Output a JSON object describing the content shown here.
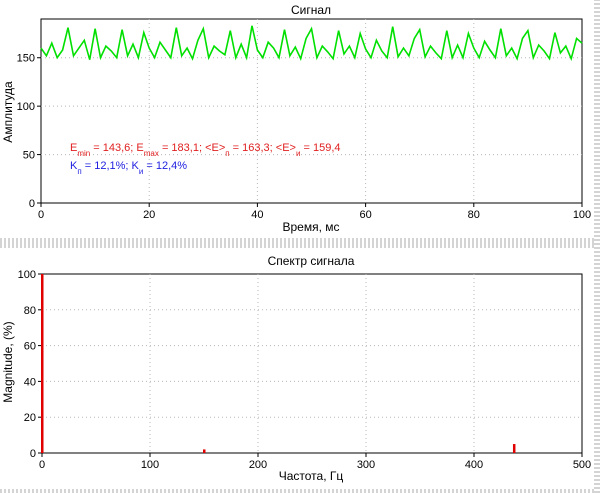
{
  "chart_data": [
    {
      "type": "line",
      "title": "Сигнал",
      "xlabel": "Время, мс",
      "ylabel": "Амплитуда",
      "xlim": [
        0,
        100
      ],
      "ylim": [
        0,
        190
      ],
      "xticks": [
        "0",
        "20",
        "40",
        "60",
        "80",
        "100"
      ],
      "yticks": [
        "0",
        "50",
        "100",
        "150"
      ],
      "grid": true,
      "color": "#00e000",
      "series": [
        {
          "x": [
            0,
            1,
            2,
            3,
            4,
            5,
            6,
            7,
            8,
            9,
            10,
            11,
            12,
            13,
            14,
            15,
            16,
            17,
            18,
            19,
            20,
            21,
            22,
            23,
            24,
            25,
            26,
            27,
            28,
            29,
            30,
            31,
            32,
            33,
            34,
            35,
            36,
            37,
            38,
            39,
            40,
            41,
            42,
            43,
            44,
            45,
            46,
            47,
            48,
            49,
            50,
            51,
            52,
            53,
            54,
            55,
            56,
            57,
            58,
            59,
            60,
            61,
            62,
            63,
            64,
            65,
            66,
            67,
            68,
            69,
            70,
            71,
            72,
            73,
            74,
            75,
            76,
            77,
            78,
            79,
            80,
            81,
            82,
            83,
            84,
            85,
            86,
            87,
            88,
            89,
            90,
            91,
            92,
            93,
            94,
            95,
            96,
            97,
            98,
            99,
            100
          ],
          "y": [
            160,
            152,
            165,
            150,
            158,
            181,
            152,
            160,
            168,
            148,
            180,
            150,
            162,
            157,
            150,
            179,
            152,
            164,
            150,
            176,
            160,
            150,
            166,
            158,
            150,
            181,
            152,
            160,
            149,
            168,
            180,
            150,
            162,
            157,
            153,
            178,
            150,
            164,
            150,
            183,
            158,
            150,
            166,
            160,
            150,
            179,
            152,
            161,
            149,
            170,
            180,
            150,
            162,
            156,
            149,
            178,
            154,
            162,
            150,
            175,
            159,
            150,
            168,
            157,
            150,
            182,
            151,
            160,
            152,
            170,
            179,
            151,
            162,
            155,
            149,
            178,
            150,
            163,
            150,
            175,
            160,
            150,
            167,
            158,
            150,
            180,
            152,
            160,
            149,
            170,
            178,
            150,
            163,
            157,
            149,
            176,
            155,
            162,
            149,
            170,
            165
          ]
        }
      ],
      "annotation_line1": {
        "emin_label": "E",
        "emin_sub": "min",
        "emin_value": " = 143,6; ",
        "emax_label": "E",
        "emax_sub": "max",
        "emax_value": " = 183,1; ",
        "ep_label": "<E>",
        "ep_sub": "п",
        "ep_value": " = 163,3; ",
        "ei_label": "<E>",
        "ei_sub": "и",
        "ei_value": " = 159,4",
        "color": "#e02020"
      },
      "annotation_line2": {
        "kp_label": "K",
        "kp_sub": "п",
        "kp_value": " = 12,1%; ",
        "ki_label": "K",
        "ki_sub": "и",
        "ki_value": " = 12,4%",
        "color": "#2020e0"
      }
    },
    {
      "type": "bar",
      "title": "Спектр сигнала",
      "xlabel": "Частота, Гц",
      "ylabel": "Magnitude, (%)",
      "xlim": [
        0,
        500
      ],
      "ylim": [
        0,
        100
      ],
      "xticks": [
        "0",
        "100",
        "200",
        "300",
        "400",
        "500"
      ],
      "yticks": [
        "0",
        "20",
        "40",
        "60",
        "80",
        "100"
      ],
      "grid": true,
      "color": "#e00000",
      "x": [
        0,
        150,
        437
      ],
      "values": [
        100,
        2,
        5
      ]
    }
  ]
}
